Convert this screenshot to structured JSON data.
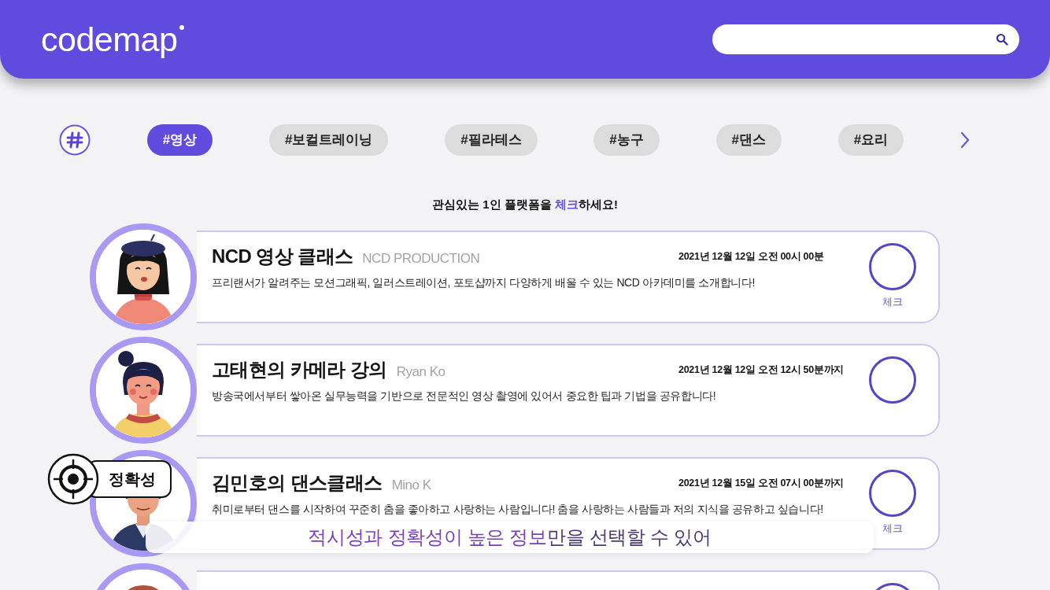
{
  "header": {
    "logo": "codemap"
  },
  "tags": [
    {
      "label": "#영상",
      "selected": true
    },
    {
      "label": "#보컬트레이닝",
      "selected": false
    },
    {
      "label": "#필라테스",
      "selected": false
    },
    {
      "label": "#농구",
      "selected": false
    },
    {
      "label": "#댄스",
      "selected": false
    },
    {
      "label": "#요리",
      "selected": false
    }
  ],
  "instruction": "관심있는 1인 플랫폼을 **체크**하세요!",
  "classes": [
    {
      "avatar": {
        "kind": "beret"
      },
      "title": "NCD 영상 클래스",
      "author": "NCD PRODUCTION",
      "date": "2021년 12월 12일 오전 00시 00분",
      "description": "프리랜서가 알려주는 모션그래픽, 일러스트레이션, 포토샵까지 다양하게 배울 수 있는 NCD 아카데미를 소개합니다!",
      "checked": false,
      "check_label": "체크"
    },
    {
      "avatar": {
        "kind": "bun"
      },
      "title": "고태현의 카메라 강의",
      "author": "Ryan Ko",
      "date": "2021년 12월 12일 오전 12시 50분까지",
      "description": "방송국에서부터 쌓아온 실무능력을 기반으로 전문적인 영상 촬영에 있어서 중요한 팁과 기법을 공유합니다!",
      "checked": false
    },
    {
      "avatar": {
        "kind": "jacket"
      },
      "title": "김민호의 댄스클래스",
      "author": "Mino K",
      "date": "2021년 12월 15일 오전 07시 00분까지",
      "description": "취미로부터 댄스를 시작하여 꾸준히 춤을 좋아하고 사랑하는 사람입니다! 춤을 사랑하는 사람들과 저의 지식을 공유하고 싶습니다!",
      "checked": false,
      "check_label": "체크"
    },
    {
      "avatar": {
        "kind": "red_hair"
      },
      "checked": false
    }
  ],
  "overlay": {
    "badge": "정확성",
    "caption": "**적시성과 정확성이 높은 정보**만을 선택할 수 있어"
  }
}
